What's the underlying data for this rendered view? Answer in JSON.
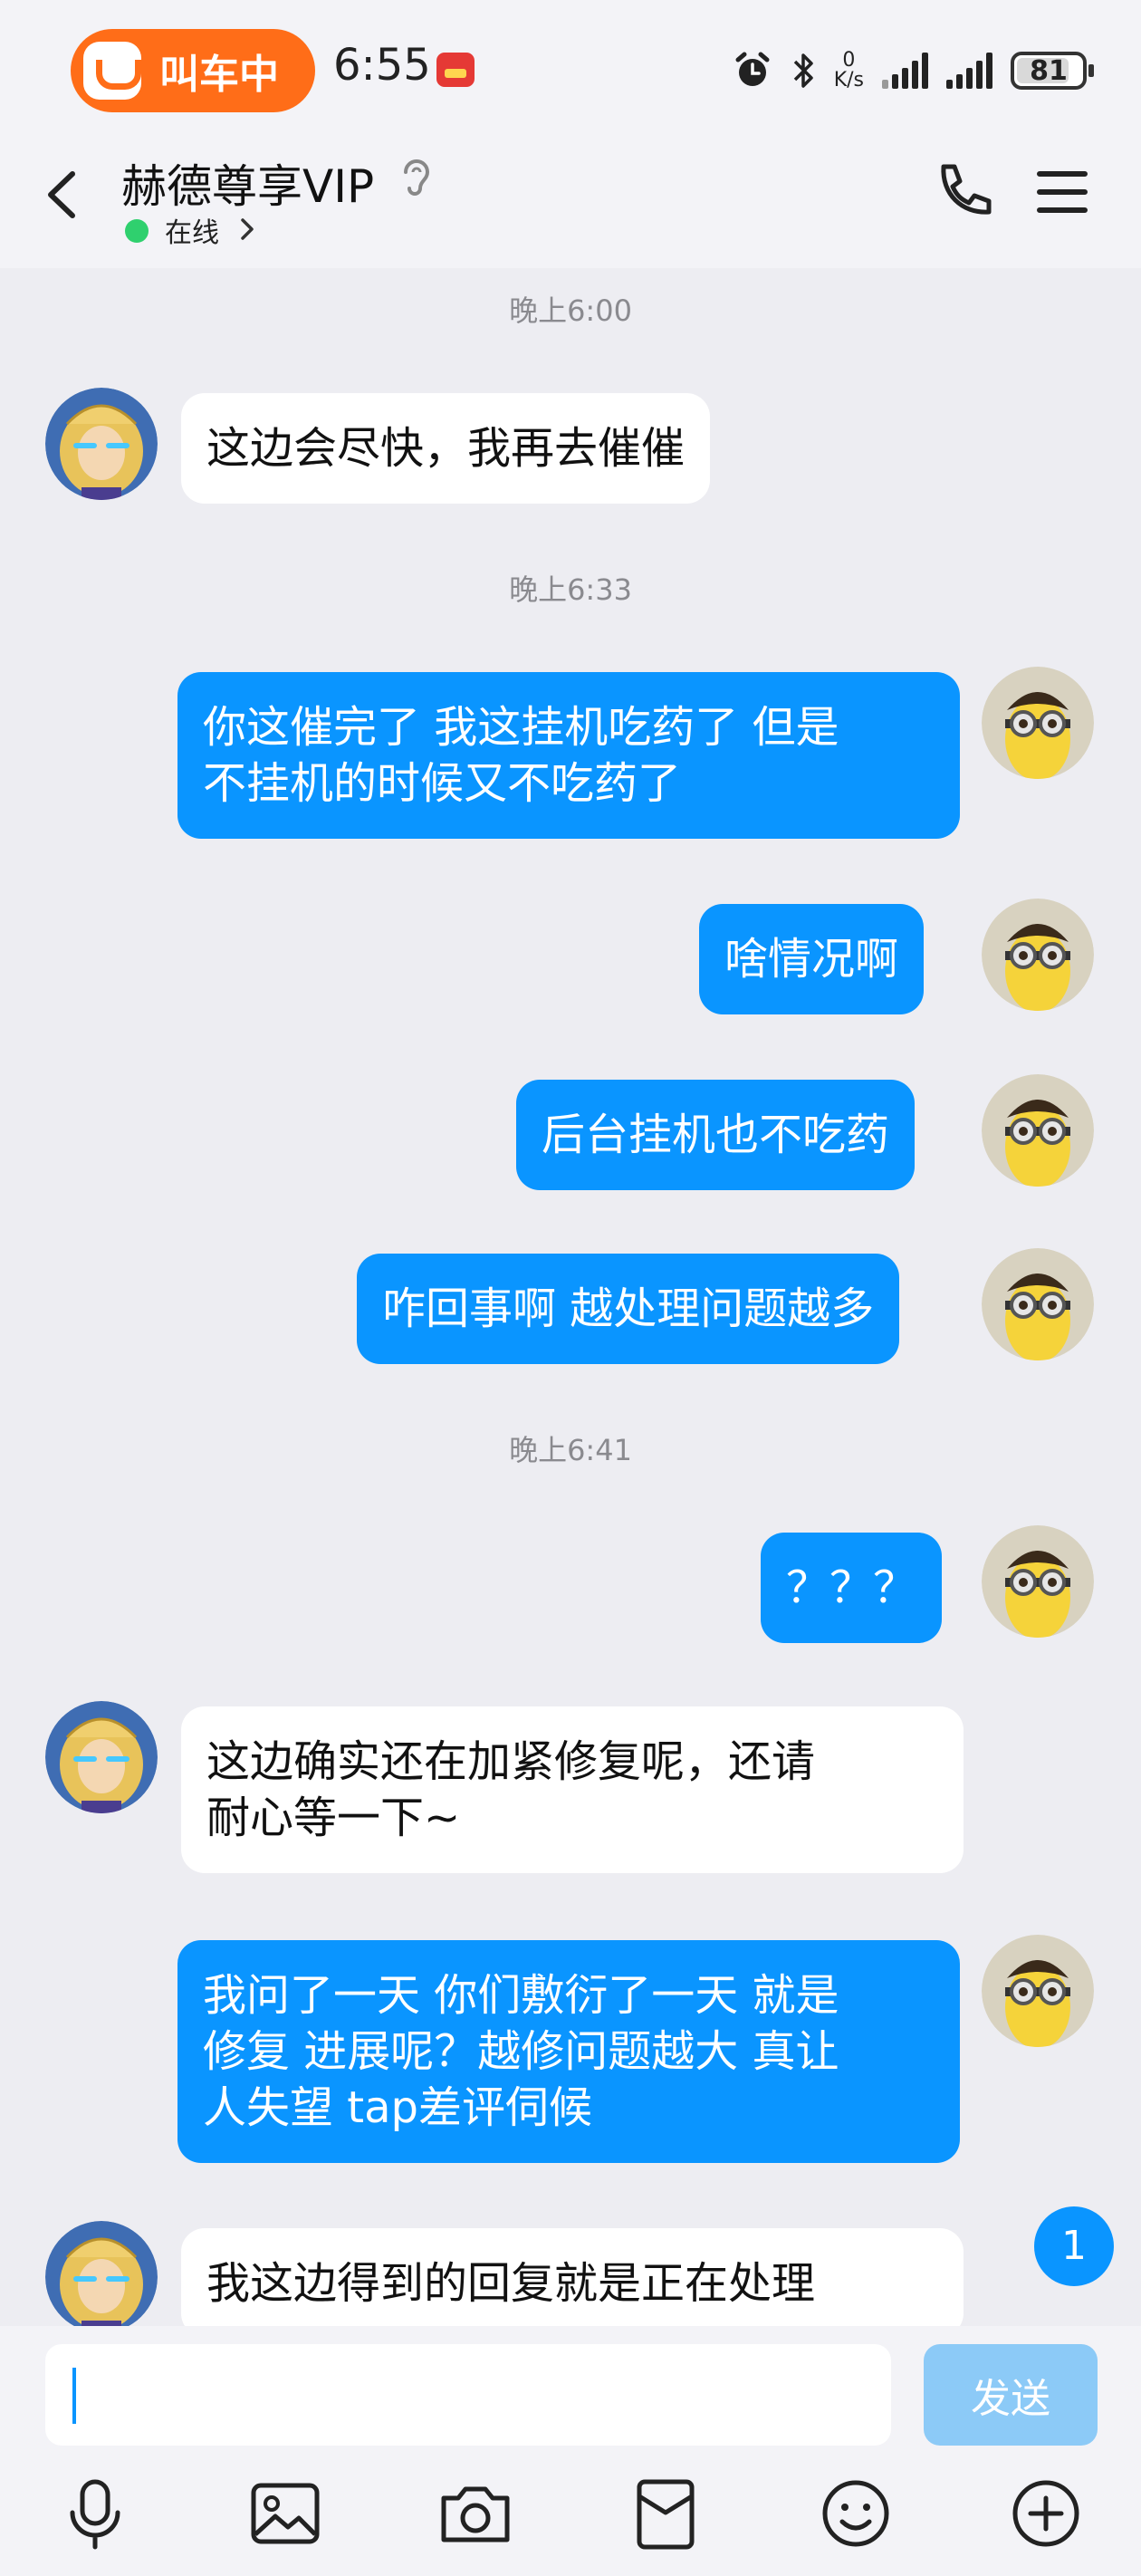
{
  "status_bar": {
    "ride_status": "叫车中",
    "time": "6:55",
    "net_speed_value": "0",
    "net_speed_unit": "K/s",
    "battery": "81",
    "battery_level": 0.81
  },
  "header": {
    "contact_name": "赫德尊享VIP",
    "status": "在线"
  },
  "messages": [
    {
      "type": "time",
      "text": "晚上6:00"
    },
    {
      "type": "in",
      "text": "这边会尽快，我再去催催"
    },
    {
      "type": "time",
      "text": "晚上6:33"
    },
    {
      "type": "out",
      "text": "你这催完了 我这挂机吃药了 但是\n不挂机的时候又不吃药了"
    },
    {
      "type": "out",
      "text": "啥情况啊"
    },
    {
      "type": "out",
      "text": "后台挂机也不吃药"
    },
    {
      "type": "out",
      "text": "咋回事啊 越处理问题越多"
    },
    {
      "type": "time",
      "text": "晚上6:41"
    },
    {
      "type": "out",
      "text": "？？？"
    },
    {
      "type": "in",
      "text": "这边确实还在加紧修复呢，还请\n耐心等一下~"
    },
    {
      "type": "out",
      "text": "我问了一天 你们敷衍了一天 就是\n修复 进展呢？越修问题越大 真让\n人失望 tap差评伺候"
    },
    {
      "type": "in",
      "text": "我这边得到的回复就是正在处理"
    }
  ],
  "unread_count": "1",
  "composer": {
    "input_value": "",
    "send_label": "发送"
  },
  "toolbar_icons": [
    "microphone-icon",
    "image-icon",
    "camera-icon",
    "red-packet-icon",
    "emoji-icon",
    "plus-icon"
  ],
  "colors": {
    "accent": "#0a95ff",
    "outgoing_bubble": "#0a95ff",
    "incoming_bubble": "#ffffff",
    "background": "#ededf2",
    "ride_pill": "#ff6d18",
    "online": "#2fd06e"
  }
}
